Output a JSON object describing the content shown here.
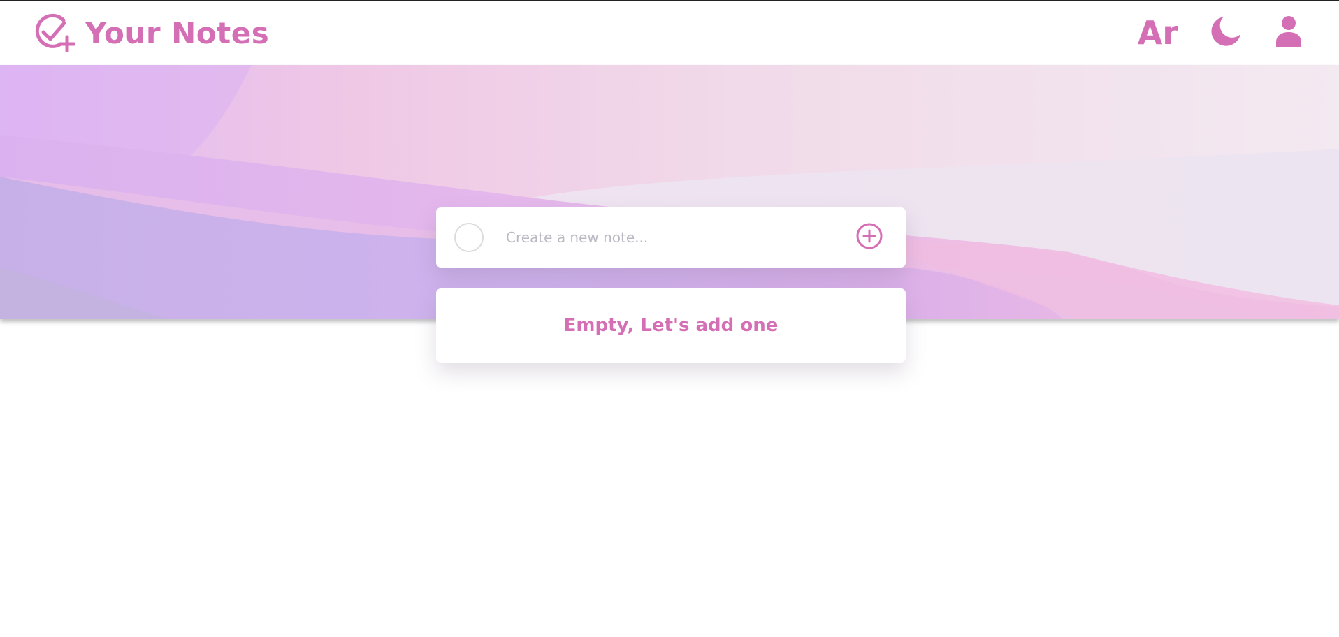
{
  "colors": {
    "accent": "#d56fb5",
    "hero_light": "#f0e2ee",
    "hero_purple": "#c9b3ec",
    "hero_pink": "#efbde2"
  },
  "header": {
    "brand_icon": "check-plus-icon",
    "title": "Your Notes",
    "language_label": "Ar",
    "theme_icon": "moon-icon",
    "profile_icon": "user-icon"
  },
  "new_note": {
    "checkbox_icon": "circle-outline-icon",
    "placeholder": "Create a new note...",
    "value": "",
    "add_icon": "plus-circle-icon"
  },
  "notes": {
    "items": [],
    "empty_message": "Empty, Let's add one"
  }
}
